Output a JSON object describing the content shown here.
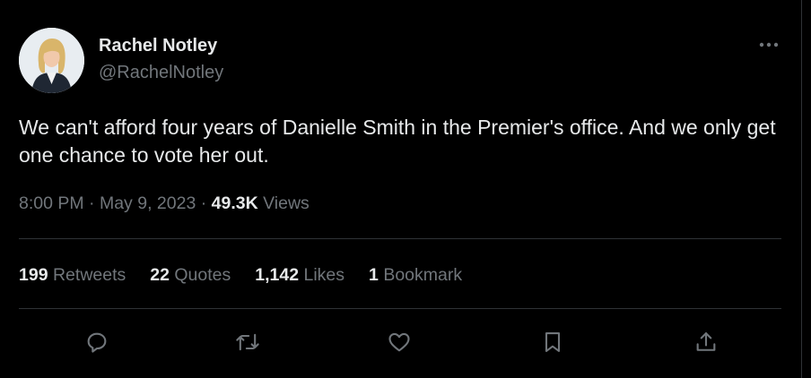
{
  "author": {
    "name": "Rachel Notley",
    "handle": "@RachelNotley"
  },
  "tweet": {
    "text": "We can't afford four years of Danielle Smith in the Premier's office. And we only get one chance to vote her out.",
    "time": "8:00 PM",
    "date": "May 9, 2023",
    "views_count": "49.3K",
    "views_label": "Views"
  },
  "stats": [
    {
      "count": "199",
      "label": "Retweets"
    },
    {
      "count": "22",
      "label": "Quotes"
    },
    {
      "count": "1,142",
      "label": "Likes"
    },
    {
      "count": "1",
      "label": "Bookmark"
    }
  ],
  "actions": [
    {
      "icon": "reply-icon"
    },
    {
      "icon": "retweet-icon"
    },
    {
      "icon": "like-icon"
    },
    {
      "icon": "bookmark-icon"
    },
    {
      "icon": "share-icon"
    }
  ],
  "colors": {
    "background": "#000000",
    "primary_text": "#e7e9ea",
    "secondary_text": "#71767b",
    "divider": "#2f3336"
  }
}
